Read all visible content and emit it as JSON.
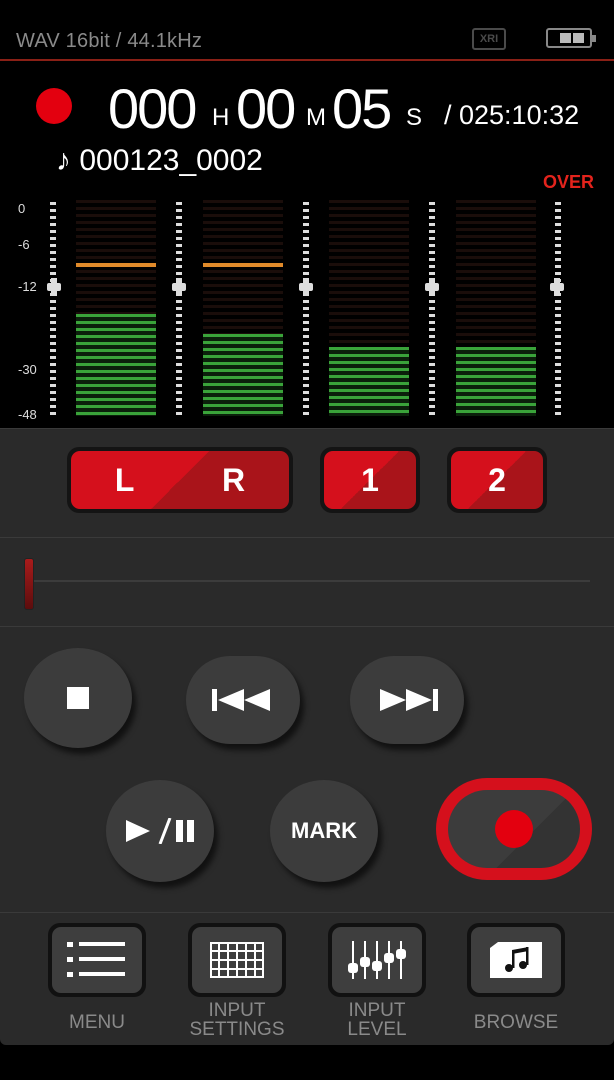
{
  "status": {
    "format": "WAV 16bit / 44.1kHz",
    "xri": "XRI"
  },
  "time": {
    "hours": "000",
    "h_unit": "H",
    "minutes": "00",
    "m_unit": "M",
    "seconds": "05",
    "s_unit": "S",
    "remaining": "/ 025:10:32"
  },
  "file": {
    "name": "♪ 000123_0002"
  },
  "meter": {
    "over_label": "OVER",
    "scale": [
      "0",
      "-6",
      "-12",
      "-30",
      "-48"
    ],
    "channels": [
      {
        "name": "L",
        "level": 0.47,
        "peak": 0.69
      },
      {
        "name": "R",
        "level": 0.38,
        "peak": 0.69
      },
      {
        "name": "1",
        "level": 0.32,
        "peak": null
      },
      {
        "name": "2",
        "level": 0.32,
        "peak": null
      }
    ]
  },
  "channels": {
    "l": "L",
    "r": "R",
    "ch1": "1",
    "ch2": "2"
  },
  "transport": {
    "mark": "MARK"
  },
  "nav": {
    "menu": "MENU",
    "input_settings_1": "INPUT",
    "input_settings_2": "SETTINGS",
    "input_level_1": "INPUT",
    "input_level_2": "LEVEL",
    "browse": "BROWSE"
  },
  "colors": {
    "accent_red": "#e3000f",
    "meter_green": "#3aa33a",
    "peak_orange": "#e08a2a"
  }
}
